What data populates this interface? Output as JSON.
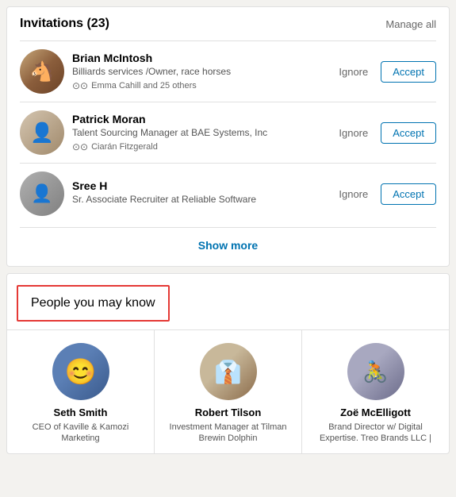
{
  "invitations": {
    "title": "Invitations",
    "count": "(23)",
    "manage_all": "Manage all",
    "items": [
      {
        "id": "brian",
        "name": "Brian McIntosh",
        "title": "Billiards services /Owner, race horses",
        "mutual": "Emma Cahill and 25 others",
        "ignore_label": "Ignore",
        "accept_label": "Accept"
      },
      {
        "id": "patrick",
        "name": "Patrick Moran",
        "title": "Talent Sourcing Manager at BAE Systems, Inc",
        "mutual": "Ciarán Fitzgerald",
        "ignore_label": "Ignore",
        "accept_label": "Accept"
      },
      {
        "id": "sree",
        "name": "Sree H",
        "title": "Sr. Associate Recruiter at Reliable Software",
        "mutual": "",
        "ignore_label": "Ignore",
        "accept_label": "Accept"
      }
    ],
    "show_more": "Show more"
  },
  "people_section": {
    "title": "People you may know",
    "people": [
      {
        "id": "seth",
        "name": "Seth Smith",
        "title": "CEO of Kaville & Kamozi Marketing"
      },
      {
        "id": "robert",
        "name": "Robert Tilson",
        "title": "Investment Manager at Tilman Brewin Dolphin"
      },
      {
        "id": "zoe",
        "name": "Zoë McElligott",
        "title": "Brand Director w/ Digital Expertise. Treo Brands LLC |"
      }
    ]
  },
  "icons": {
    "connection": "⊙"
  }
}
